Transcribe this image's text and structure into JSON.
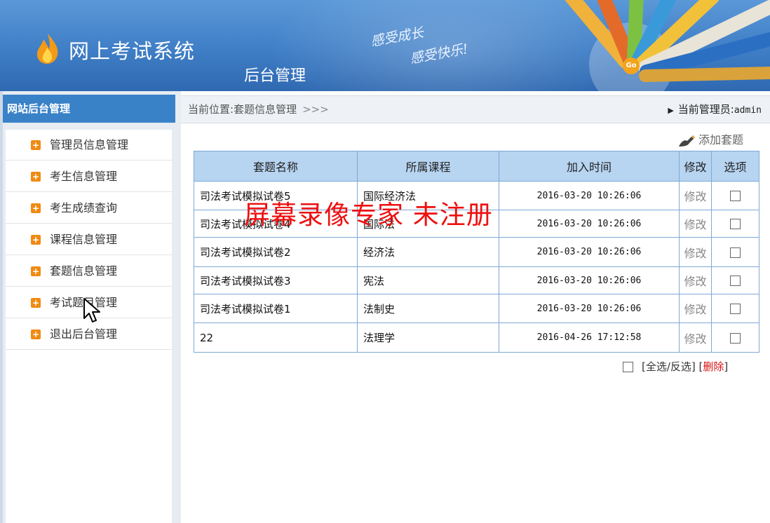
{
  "header": {
    "system_title": "网上考试系统",
    "subtitle": "后台管理",
    "slogan_line1": "感受成长",
    "slogan_line2": "感受快乐!",
    "go_badge": "Go"
  },
  "sidebar": {
    "title": "网站后台管理",
    "items": [
      {
        "label": "管理员信息管理"
      },
      {
        "label": "考生信息管理"
      },
      {
        "label": "考生成绩查询"
      },
      {
        "label": "课程信息管理"
      },
      {
        "label": "套题信息管理"
      },
      {
        "label": "考试题目管理"
      },
      {
        "label": "退出后台管理"
      }
    ]
  },
  "breadcrumb": {
    "prefix": "当前位置:",
    "current": "套题信息管理",
    "separator": ">>>"
  },
  "admin": {
    "label": "当前管理员:",
    "name": "admin"
  },
  "actions": {
    "add_label": "添加套题"
  },
  "table": {
    "headers": [
      "套题名称",
      "所属课程",
      "加入时间",
      "修改",
      "选项"
    ],
    "rows": [
      {
        "name": "司法考试模拟试卷5",
        "course": "国际经济法",
        "time": "2016-03-20 10:26:06",
        "edit": "修改"
      },
      {
        "name": "司法考试模拟试卷4",
        "course": "国际法",
        "time": "2016-03-20 10:26:06",
        "edit": "修改"
      },
      {
        "name": "司法考试模拟试卷2",
        "course": "经济法",
        "time": "2016-03-20 10:26:06",
        "edit": "修改"
      },
      {
        "name": "司法考试模拟试卷3",
        "course": "宪法",
        "time": "2016-03-20 10:26:06",
        "edit": "修改"
      },
      {
        "name": "司法考试模拟试卷1",
        "course": "法制史",
        "time": "2016-03-20 10:26:06",
        "edit": "修改"
      },
      {
        "name": "22",
        "course": "法理学",
        "time": "2016-04-26 17:12:58",
        "edit": "修改"
      }
    ]
  },
  "footer": {
    "select_all_label": "[全选/反选]",
    "delete_open": "[",
    "delete_label": "删除",
    "delete_close": "]"
  },
  "watermark": {
    "text": "屏幕录像专家  未注册"
  },
  "colors": {
    "header_blue": "#3f7ec6",
    "sidebar_head": "#3a82c8",
    "table_header": "#b7d4f1",
    "table_border": "#7ea9d6",
    "bullet_orange": "#f08a12",
    "delete_red": "#d81010",
    "watermark_red": "#ee1010"
  },
  "icons": {
    "logo": "flame-icon",
    "bullet": "plus-square-icon",
    "add": "pen-icon",
    "breadcrumb_arrow": "triangle-right-icon",
    "cursor": "mouse-pointer-icon"
  }
}
